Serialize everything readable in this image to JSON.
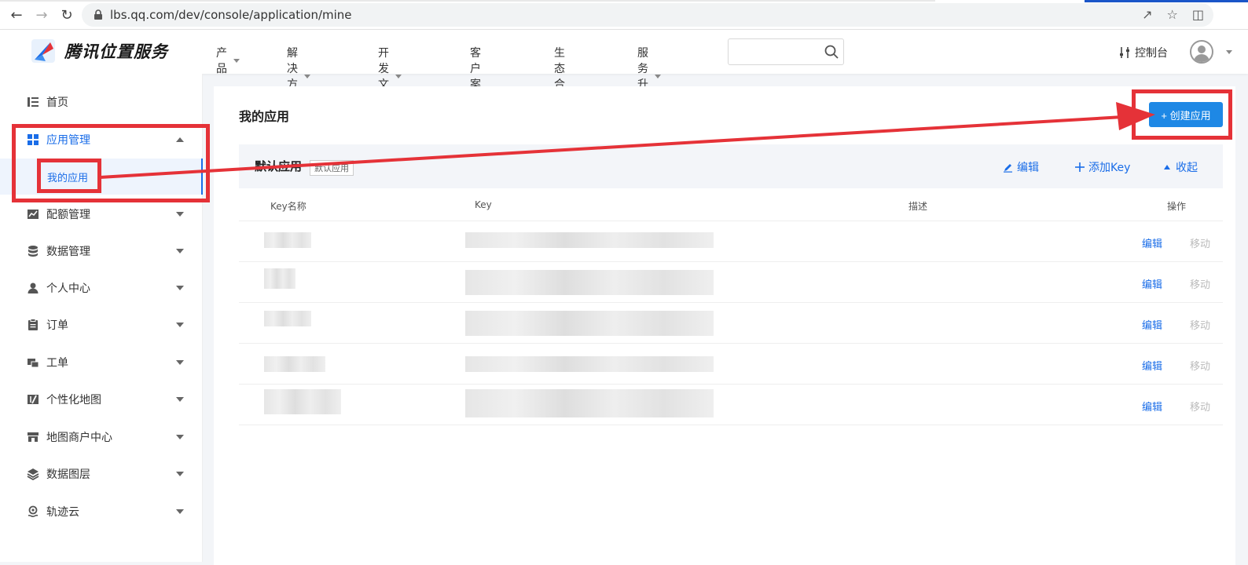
{
  "browser": {
    "url": "lbs.qq.com/dev/console/application/mine"
  },
  "header": {
    "logo_text": "腾讯位置服务",
    "menu": [
      {
        "label": "产品",
        "dropdown": true
      },
      {
        "label": "解决方案",
        "dropdown": true
      },
      {
        "label": "开发文档",
        "dropdown": true
      },
      {
        "label": "客户案例",
        "dropdown": false
      },
      {
        "label": "生态合作",
        "dropdown": false
      },
      {
        "label": "服务升级",
        "dropdown": true
      }
    ],
    "search_placeholder": "",
    "console_label": "控制台"
  },
  "sidebar": {
    "items": [
      {
        "label": "首页",
        "icon": "list-icon"
      },
      {
        "label": "应用管理",
        "icon": "grid-icon",
        "expanded": true
      },
      {
        "label": "配额管理",
        "icon": "chart-icon"
      },
      {
        "label": "数据管理",
        "icon": "database-icon"
      },
      {
        "label": "个人中心",
        "icon": "user-icon"
      },
      {
        "label": "订单",
        "icon": "clipboard-icon"
      },
      {
        "label": "工单",
        "icon": "ticket-icon"
      },
      {
        "label": "个性化地图",
        "icon": "map-edit-icon"
      },
      {
        "label": "地图商户中心",
        "icon": "store-icon"
      },
      {
        "label": "数据图层",
        "icon": "layers-icon"
      },
      {
        "label": "轨迹云",
        "icon": "track-icon"
      }
    ],
    "sub_item": "我的应用"
  },
  "main": {
    "title": "我的应用",
    "create_button": "+ 创建应用",
    "app": {
      "name": "默认应用",
      "tag": "默认应用",
      "edit": "编辑",
      "add_key": "添加Key",
      "collapse": "收起"
    },
    "table": {
      "headers": [
        "Key名称",
        "Key",
        "描述",
        "操作"
      ],
      "rows": [
        {
          "edit": "编辑",
          "move": "移动"
        },
        {
          "edit": "编辑",
          "move": "移动"
        },
        {
          "edit": "编辑",
          "move": "移动"
        },
        {
          "edit": "编辑",
          "move": "移动"
        },
        {
          "edit": "编辑",
          "move": "移动"
        }
      ]
    }
  },
  "colors": {
    "accent": "#1e88e5",
    "link": "#1a6de8",
    "annotation": "#e53238"
  }
}
